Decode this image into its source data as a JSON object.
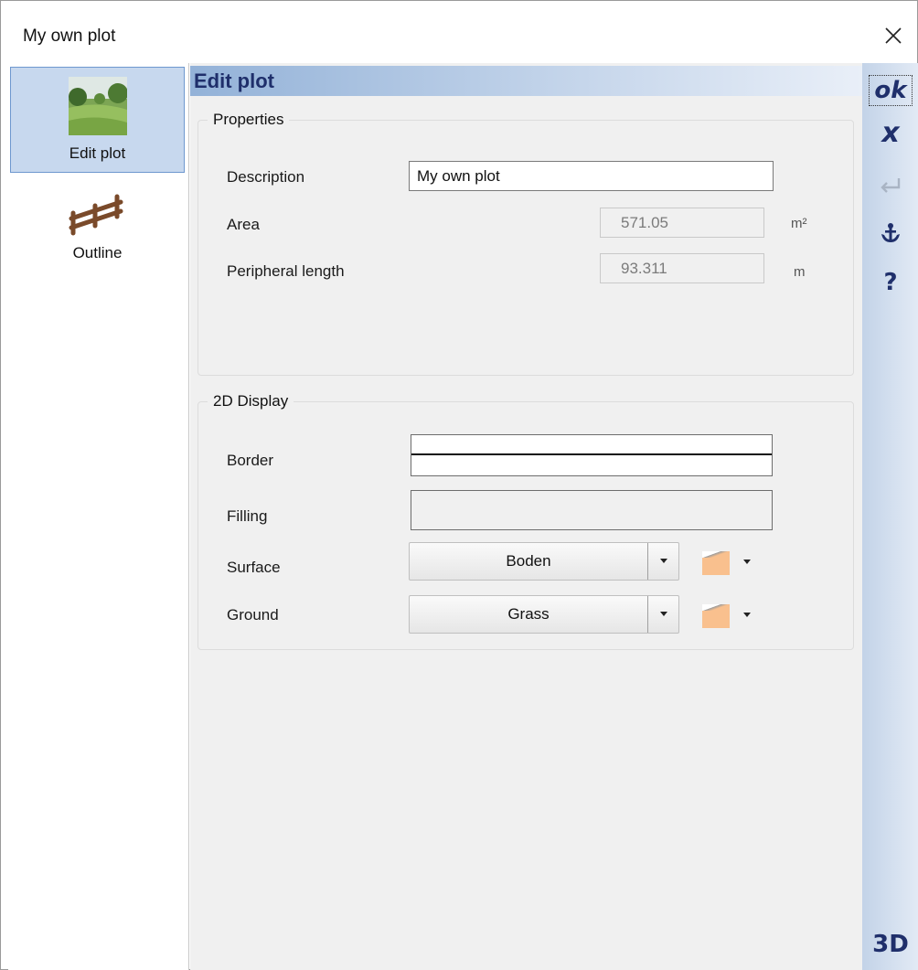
{
  "window": {
    "title": "My own plot",
    "close_icon": "close-icon"
  },
  "sidebar": {
    "items": [
      {
        "label": "Edit plot",
        "icon": "landscape-photo-icon",
        "selected": true
      },
      {
        "label": "Outline",
        "icon": "fence-outline-icon",
        "selected": false
      }
    ]
  },
  "main": {
    "header": "Edit plot",
    "properties": {
      "legend": "Properties",
      "description_label": "Description",
      "description_value": "My own plot",
      "area_label": "Area",
      "area_value": "571.05",
      "area_unit": "m²",
      "perimeter_label": "Peripheral length",
      "perimeter_value": "93.311",
      "perimeter_unit": "m"
    },
    "display": {
      "legend": "2D Display",
      "border_label": "Border",
      "filling_label": "Filling",
      "surface_label": "Surface",
      "surface_value": "Boden",
      "ground_label": "Ground",
      "ground_value": "Grass",
      "swatch_color": "#f9c08e"
    }
  },
  "toolbar": {
    "ok": "ok",
    "cancel": "x",
    "help": "?",
    "view3d": "3D",
    "colors": {
      "accent": "#1f2f6b",
      "disabled": "#a9b4c4"
    }
  }
}
